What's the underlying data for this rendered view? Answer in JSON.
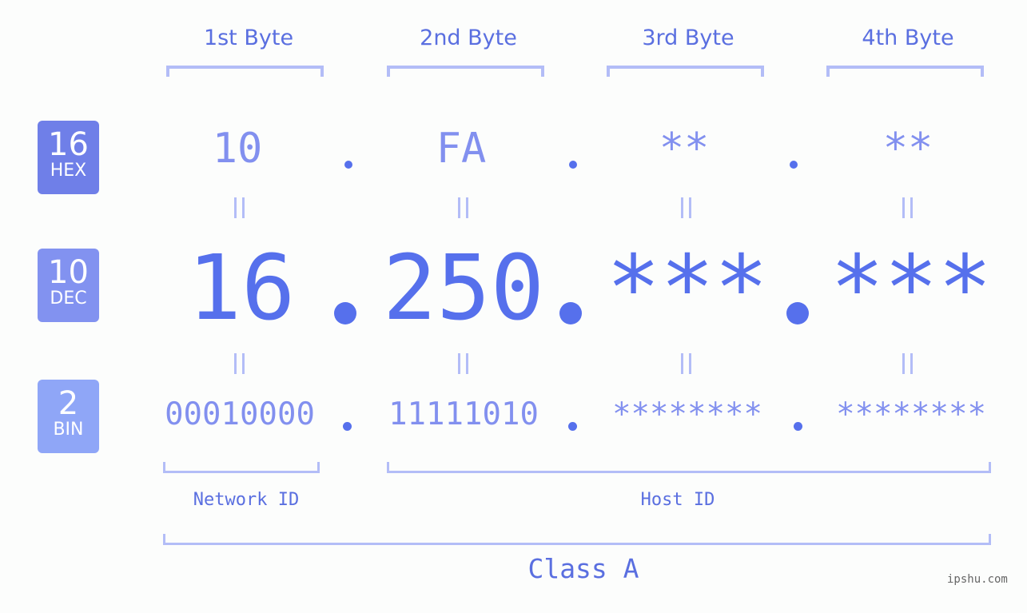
{
  "bytes": [
    {
      "header": "1st Byte",
      "hex": "10",
      "dec": "16",
      "bin": "00010000"
    },
    {
      "header": "2nd Byte",
      "hex": "FA",
      "dec": "250",
      "bin": "11111010"
    },
    {
      "header": "3rd Byte",
      "hex": "**",
      "dec": "***",
      "bin": "********"
    },
    {
      "header": "4th Byte",
      "hex": "**",
      "dec": "***",
      "bin": "********"
    }
  ],
  "badges": {
    "hex": {
      "num": "16",
      "label": "HEX",
      "color": "#6f7fe8"
    },
    "dec": {
      "num": "10",
      "label": "DEC",
      "color": "#8292f0"
    },
    "bin": {
      "num": "2",
      "label": "BIN",
      "color": "#8fa6f7"
    }
  },
  "labels": {
    "network_id": "Network ID",
    "host_id": "Host ID",
    "class": "Class A"
  },
  "watermark": "ipshu.com",
  "colors": {
    "accent": "#5670ec",
    "light": "#8290ef",
    "bracket": "#b3bdf7"
  }
}
